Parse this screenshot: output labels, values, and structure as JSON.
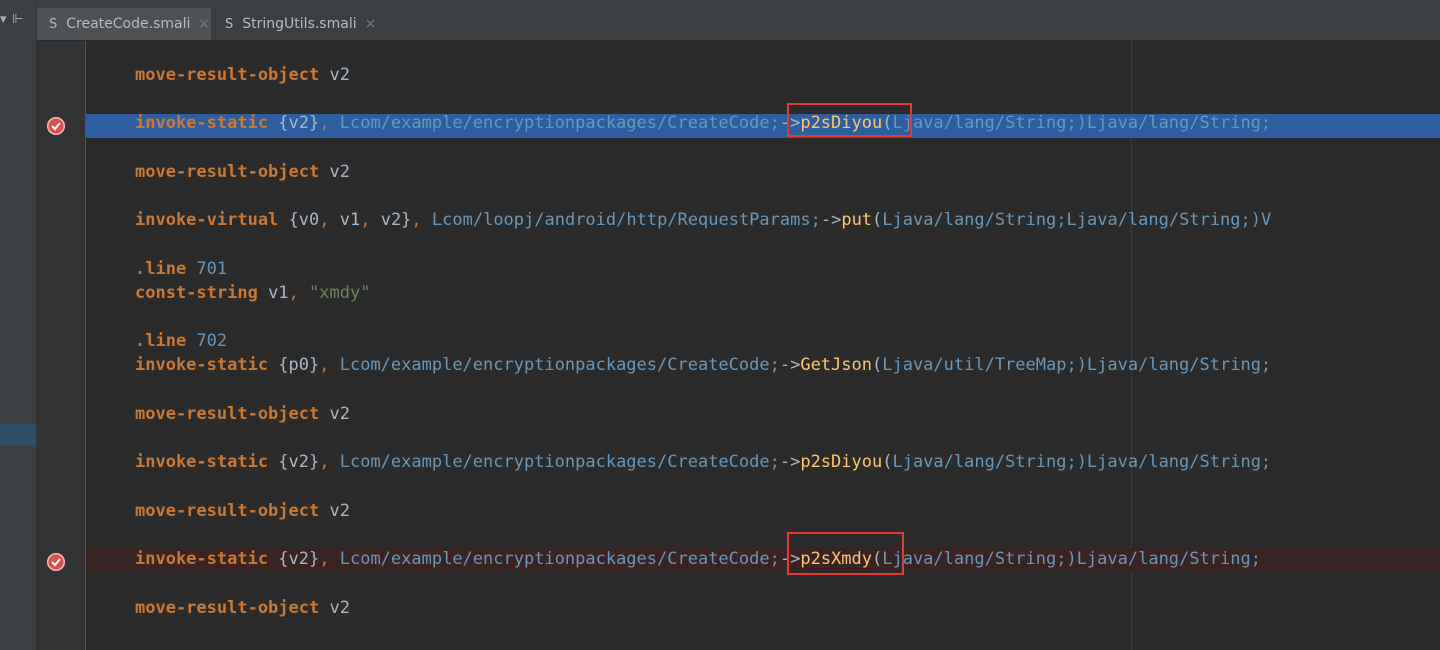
{
  "tabs": [
    {
      "label": "CreateCode.smali",
      "type_icon": "S",
      "close": "×",
      "active": true
    },
    {
      "label": "StringUtils.smali",
      "type_icon": "S",
      "close": "×",
      "active": false
    }
  ],
  "toolbar": {
    "icon1": "▾",
    "icon2": "⊩"
  },
  "code": [
    {
      "kw": "move-result-object",
      "r1": " v2"
    },
    {
      "kw": "invoke-static",
      "regs": " {v2}",
      "sep": ", ",
      "cls": "Lcom/example/encryptionpackages/CreateCode;",
      "arrow": "->",
      "method": "p2sDiyou",
      "paren": "(",
      "sig": "Ljava/lang/String;)Ljava/lang/String;",
      "breakpoint": true,
      "highlight": "current"
    },
    {
      "kw": "move-result-object",
      "r1": " v2"
    },
    {
      "kw": "invoke-virtual",
      "reg_open": " {v0",
      "c1": ", ",
      "reg_b": "v1",
      "c2": ", ",
      "reg_c": "v2}",
      "sep": ", ",
      "cls": "Lcom/loopj/android/http/RequestParams;",
      "arrow": "->",
      "method": "put",
      "paren": "(",
      "sig": "Ljava/lang/String;Ljava/lang/String;)V"
    },
    {
      "kw": ".line",
      "num": " 701"
    },
    {
      "kw": "const-string",
      "r1": " v1",
      "sep": ", ",
      "str": "\"xmdy\""
    },
    {
      "kw": ".line",
      "num": " 702"
    },
    {
      "kw": "invoke-static",
      "regs": " {p0}",
      "sep": ", ",
      "cls": "Lcom/example/encryptionpackages/CreateCode;",
      "arrow": "->",
      "method": "GetJson",
      "paren": "(",
      "sig": "Ljava/util/TreeMap;)Ljava/lang/String;"
    },
    {
      "kw": "move-result-object",
      "r1": " v2"
    },
    {
      "kw": "invoke-static",
      "regs": " {v2}",
      "sep": ", ",
      "cls": "Lcom/example/encryptionpackages/CreateCode;",
      "arrow": "->",
      "method": "p2sDiyou",
      "paren": "(",
      "sig": "Ljava/lang/String;)Ljava/lang/String;"
    },
    {
      "kw": "move-result-object",
      "r1": " v2"
    },
    {
      "kw": "invoke-static",
      "regs": " {v2}",
      "sep": ", ",
      "cls": "Lcom/example/encryptionpackages/CreateCode;",
      "arrow": "->",
      "method": "p2sXmdy",
      "paren": "(",
      "sig": "Ljava/lang/String;)Ljava/lang/String;",
      "breakpoint": true,
      "highlight": "breakpoint"
    },
    {
      "kw": "move-result-object",
      "r1": " v2"
    }
  ],
  "colors": {
    "keyword": "#cc7832",
    "class_ref": "#6897bb",
    "method": "#ffc66d",
    "string": "#6a8759",
    "current_line": "#2d5fa0",
    "breakpoint_line": "#3a2323",
    "annotation_box": "#e53935"
  }
}
